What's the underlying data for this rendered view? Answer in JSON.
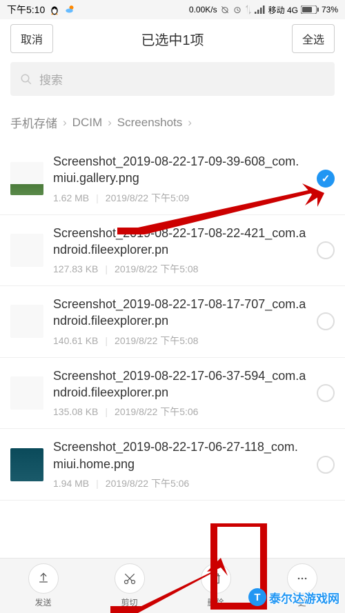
{
  "status_bar": {
    "time": "下午5:10",
    "speed": "0.00K/s",
    "carrier": "移动 4G",
    "battery": "73%"
  },
  "header": {
    "cancel": "取消",
    "title": "已选中1项",
    "select_all": "全选"
  },
  "search": {
    "placeholder": "搜索"
  },
  "breadcrumb": {
    "items": [
      "手机存储",
      "DCIM",
      "Screenshots"
    ]
  },
  "files": [
    {
      "name": "Screenshot_2019-08-22-17-09-39-608_com.miui.gallery.png",
      "size": "1.62 MB",
      "date": "2019/8/22 下午5:09",
      "selected": true,
      "thumb": "gallery"
    },
    {
      "name": "Screenshot_2019-08-22-17-08-22-421_com.android.fileexplorer.pn",
      "size": "127.83 KB",
      "date": "2019/8/22 下午5:08",
      "selected": false,
      "thumb": "fe"
    },
    {
      "name": "Screenshot_2019-08-22-17-08-17-707_com.android.fileexplorer.pn",
      "size": "140.61 KB",
      "date": "2019/8/22 下午5:08",
      "selected": false,
      "thumb": "fe"
    },
    {
      "name": "Screenshot_2019-08-22-17-06-37-594_com.android.fileexplorer.pn",
      "size": "135.08 KB",
      "date": "2019/8/22 下午5:06",
      "selected": false,
      "thumb": "fe"
    },
    {
      "name": "Screenshot_2019-08-22-17-06-27-118_com.miui.home.png",
      "size": "1.94 MB",
      "date": "2019/8/22 下午5:06",
      "selected": false,
      "thumb": "home"
    }
  ],
  "bottom": {
    "send": "发送",
    "cut": "剪切",
    "delete": "删除",
    "more": "更"
  },
  "watermark": "泰尔达游戏网"
}
